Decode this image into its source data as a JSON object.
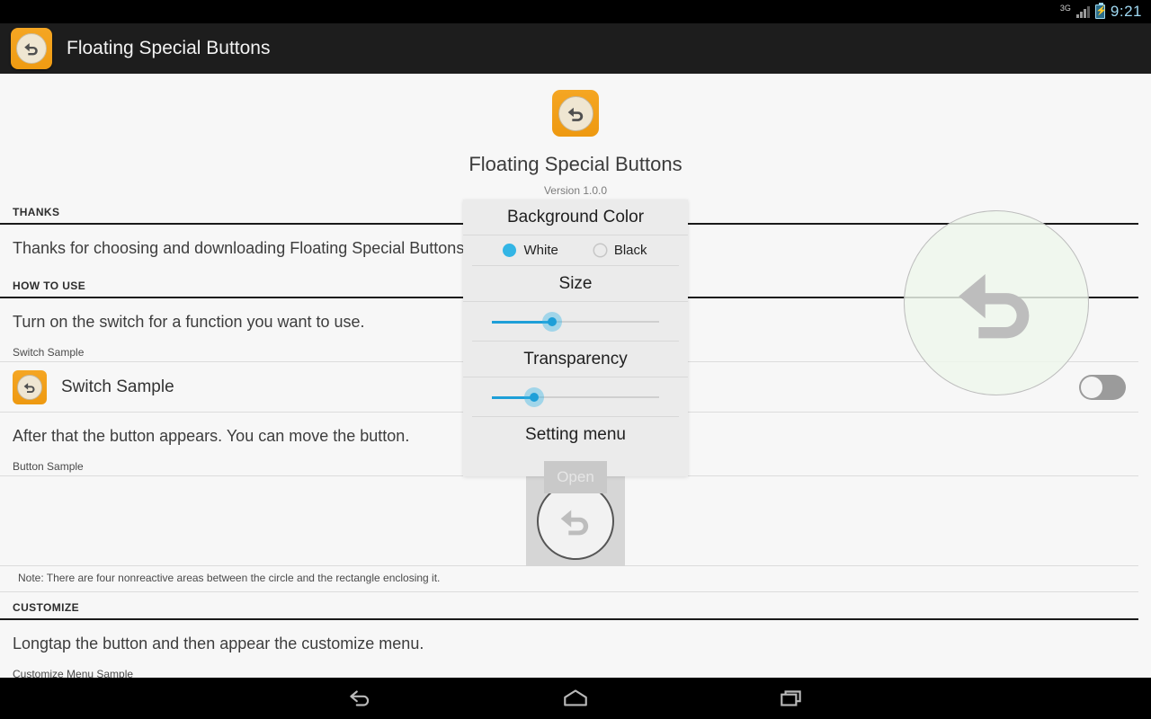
{
  "status_bar": {
    "network_label": "3G",
    "time": "9:21",
    "battery_icon": "battery-charging-icon",
    "signal_icon": "signal-bars-icon"
  },
  "action_bar": {
    "app_icon": "app-back-arrow-icon",
    "title": "Floating Special Buttons"
  },
  "app_header": {
    "icon": "app-back-arrow-icon",
    "name": "Floating Special Buttons",
    "version": "Version 1.0.0"
  },
  "sections": {
    "thanks": {
      "header": "THANKS",
      "body": "Thanks for choosing and downloading Floating Special Buttons!"
    },
    "how_to_use": {
      "header": "HOW TO USE",
      "intro": "Turn on the switch for a function you want to use.",
      "switch_sample_label": "Switch Sample",
      "switch_row_title": "Switch Sample",
      "switch_state": "off",
      "after_text": "After that the button appears. You can move the button.",
      "button_sample_label": "Button Sample",
      "note": "Note: There are four nonreactive areas between the circle and the rectangle enclosing it."
    },
    "customize": {
      "header": "CUSTOMIZE",
      "body": "Longtap the button and then appear the customize menu.",
      "sample_label": "Customize Menu Sample"
    }
  },
  "dialog": {
    "background_color": {
      "title": "Background Color",
      "options": [
        {
          "label": "White",
          "selected": true
        },
        {
          "label": "Black",
          "selected": false
        }
      ]
    },
    "size": {
      "title": "Size",
      "value_percent": 36
    },
    "transparency": {
      "title": "Transparency",
      "value_percent": 25
    },
    "setting_menu": {
      "title": "Setting menu",
      "open_label": "Open"
    }
  },
  "floating_preview": {
    "icon": "back-arrow-icon"
  },
  "nav_bar": {
    "back": "back-icon",
    "home": "home-icon",
    "recents": "recents-icon"
  },
  "colors": {
    "accent": "#33b5e5",
    "brand_orange": "#f5a623",
    "page_bg": "#f7f7f7",
    "dialog_bg": "#ebebeb"
  }
}
